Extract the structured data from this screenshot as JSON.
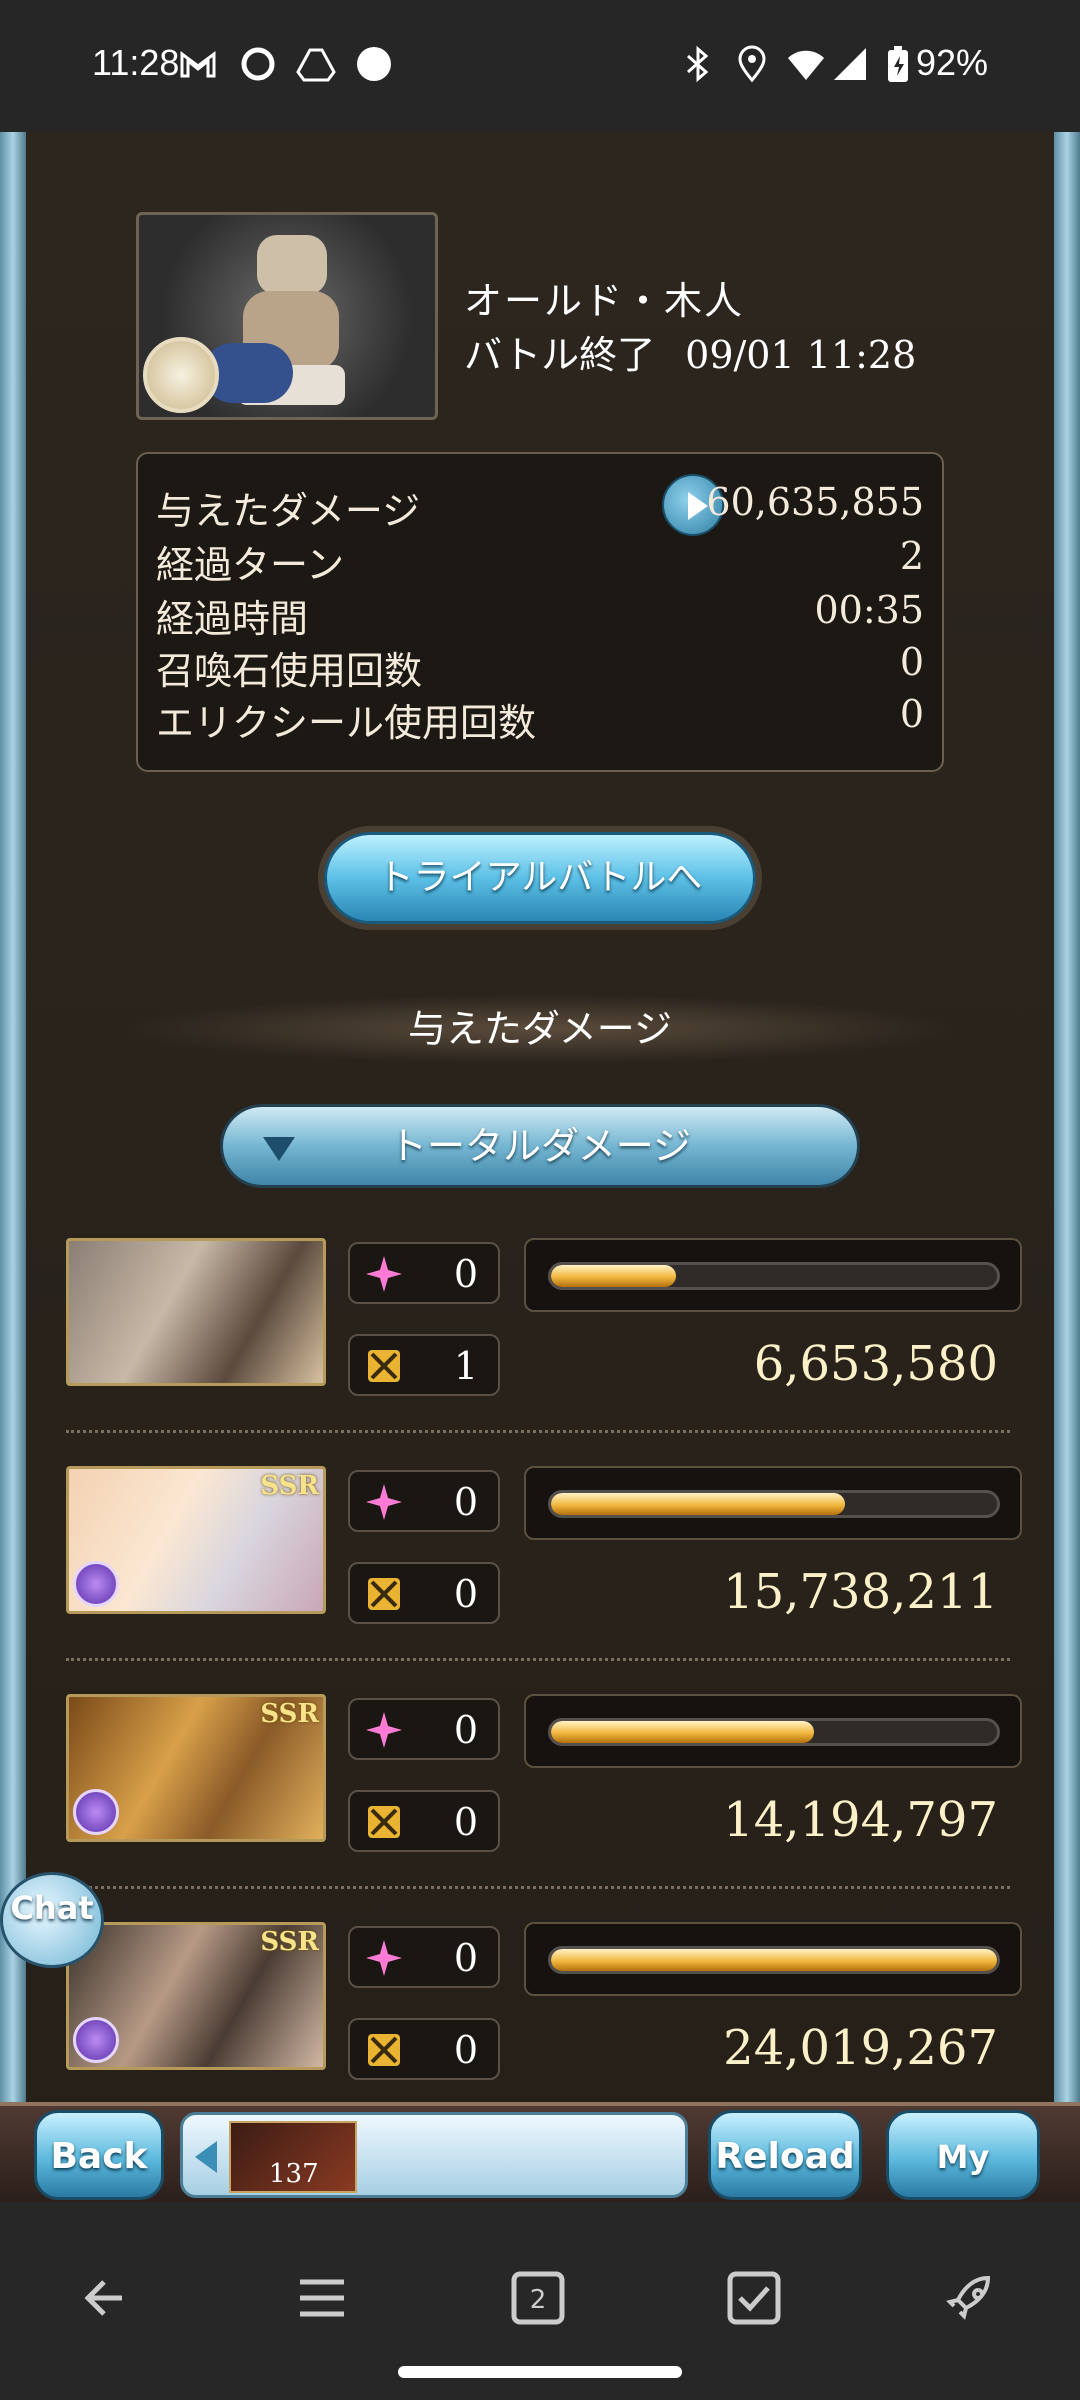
{
  "status_bar": {
    "time": "11:28",
    "battery": "92%",
    "icons": [
      "gmail-icon",
      "sync-circle-icon",
      "drive-icon",
      "record-dot-icon",
      "bluetooth-icon",
      "location-icon",
      "wifi-icon",
      "signal-icon",
      "battery-icon"
    ]
  },
  "boss": {
    "name": "オールド・木人",
    "status_label": "バトル終了",
    "timestamp": "09/01 11:28"
  },
  "stats": [
    {
      "label": "与えたダメージ",
      "value": "60,635,855"
    },
    {
      "label": "経過ターン",
      "value": "2"
    },
    {
      "label": "経過時間",
      "value": "00:35"
    },
    {
      "label": "召喚石使用回数",
      "value": "0"
    },
    {
      "label": "エリクシール使用回数",
      "value": "0"
    }
  ],
  "trial_button": "トライアルバトルへ",
  "section_title": "与えたダメージ",
  "dropdown": {
    "selected": "トータルダメージ"
  },
  "members": [
    {
      "ca_count": "0",
      "skill_count": "1",
      "damage": "6,653,580",
      "bar_fraction": 0.28,
      "ssr": false,
      "elem": false
    },
    {
      "ca_count": "0",
      "skill_count": "0",
      "damage": "15,738,211",
      "bar_fraction": 0.66,
      "ssr": true,
      "elem": true
    },
    {
      "ca_count": "0",
      "skill_count": "0",
      "damage": "14,194,797",
      "bar_fraction": 0.59,
      "ssr": true,
      "elem": true
    },
    {
      "ca_count": "0",
      "skill_count": "0",
      "damage": "24,019,267",
      "bar_fraction": 1.0,
      "ssr": true,
      "elem": true
    }
  ],
  "ssr_label": "SSR",
  "chat_label": "Chat",
  "bottom": {
    "back": "Back",
    "reload": "Reload",
    "mypage": "My page",
    "quick_count": "137"
  },
  "colors": {
    "accent_blue": "#5cb9dd",
    "gold_bar": "#f1b73d",
    "panel_bg": "#2a241d"
  }
}
